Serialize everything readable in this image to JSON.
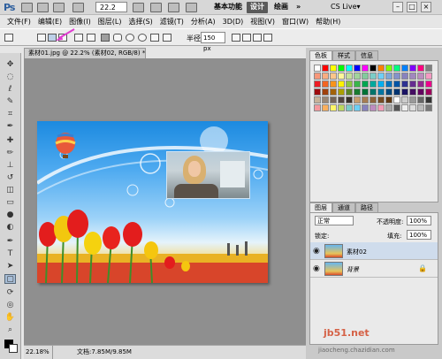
{
  "app": {
    "logo": "Ps",
    "zoom": "22.2",
    "workspaces": [
      "基本功能",
      "设计",
      "绘画",
      "»"
    ],
    "cslive": "CS Live▾"
  },
  "menu": [
    "文件(F)",
    "编辑(E)",
    "图像(I)",
    "图层(L)",
    "选择(S)",
    "滤镜(T)",
    "分析(A)",
    "3D(D)",
    "视图(V)",
    "窗口(W)",
    "帮助(H)"
  ],
  "options": {
    "radius_label": "半径:",
    "radius_value": "150 px"
  },
  "document": {
    "tab": "素材01.jpg @ 22.2% (素材02, RGB/8) *",
    "status_zoom": "22.18%",
    "status_doc": "文档:7.85M/9.85M"
  },
  "swatches": {
    "tabs": [
      "色板",
      "样式",
      "信息"
    ],
    "colors": [
      "#ffffff",
      "#ff0000",
      "#ffff00",
      "#00ff00",
      "#00ffff",
      "#0000ff",
      "#ff00ff",
      "#000000",
      "#ff8000",
      "#80ff00",
      "#00ff80",
      "#0080ff",
      "#8000ff",
      "#ff0080",
      "#808080",
      "#f7977a",
      "#f9ad81",
      "#fdc68a",
      "#fff79a",
      "#c4df9b",
      "#a2d39c",
      "#82ca9d",
      "#7bcdc8",
      "#6ecff6",
      "#7ea7d8",
      "#8493ca",
      "#8882be",
      "#a187be",
      "#bc8dbf",
      "#f49ac2",
      "#ed1c24",
      "#f26522",
      "#f7941d",
      "#fff200",
      "#8dc63f",
      "#39b54a",
      "#00a651",
      "#00a99d",
      "#00aeef",
      "#0072bc",
      "#0054a6",
      "#2e3192",
      "#662d91",
      "#92278f",
      "#ec008c",
      "#9e0b0f",
      "#a0410d",
      "#a36209",
      "#aba000",
      "#598527",
      "#197b30",
      "#007236",
      "#00746b",
      "#0076a3",
      "#004b80",
      "#003471",
      "#1b1464",
      "#440e62",
      "#630460",
      "#9e005d",
      "#c7b299",
      "#998675",
      "#736357",
      "#534741",
      "#37302a",
      "#c69c6d",
      "#a67c52",
      "#8c6239",
      "#754c24",
      "#603913",
      "#ffffff",
      "#cccccc",
      "#999999",
      "#666666",
      "#333333",
      "#f5989d",
      "#fbaf5d",
      "#fff568",
      "#bcd85f",
      "#7accc8",
      "#6dcff6",
      "#8781bd",
      "#bd8cbf",
      "#f19cb6",
      "#aaaaaa",
      "#555555",
      "#eeeeee",
      "#dddddd",
      "#bbbbbb",
      "#777777"
    ]
  },
  "layers": {
    "tabs": [
      "图层",
      "通道",
      "路径"
    ],
    "blend": "正常",
    "opacity_label": "不透明度:",
    "opacity": "100%",
    "lock_label": "锁定:",
    "fill_label": "填充:",
    "fill": "100%",
    "items": [
      {
        "name": "素材02",
        "selected": true
      },
      {
        "name": "背景",
        "selected": false
      }
    ]
  },
  "watermark": {
    "line1": "jb51.net",
    "line2": "jiaocheng.chazidian.com"
  }
}
